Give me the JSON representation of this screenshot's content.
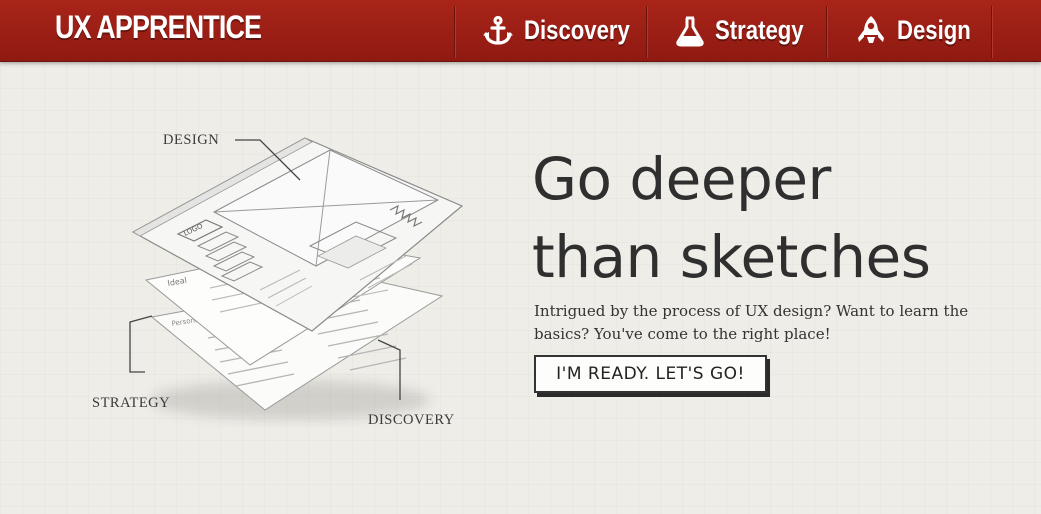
{
  "header": {
    "brand": "UX APPRENTICE",
    "nav": [
      {
        "label": "Discovery",
        "icon": "anchor-icon"
      },
      {
        "label": "Strategy",
        "icon": "flask-icon"
      },
      {
        "label": "Design",
        "icon": "rocket-icon"
      }
    ]
  },
  "hero": {
    "headline_line1": "Go deeper",
    "headline_line2": "than sketches",
    "subtext": "Intrigued by the process of UX design? Want to learn the basics? You've come to the right place!",
    "cta_label": "I'M READY. LET'S GO!"
  },
  "illustration": {
    "callout_design": "DESIGN",
    "callout_strategy": "STRATEGY",
    "callout_discovery": "DISCOVERY",
    "wireframe_logo_text": "LOGO",
    "strategy_sheet_text": "Ideal",
    "discovery_sheet_text": "Persona"
  },
  "colors": {
    "header_red": "#9e2016",
    "background": "#efede7",
    "text_dark": "#2f2f2f"
  }
}
